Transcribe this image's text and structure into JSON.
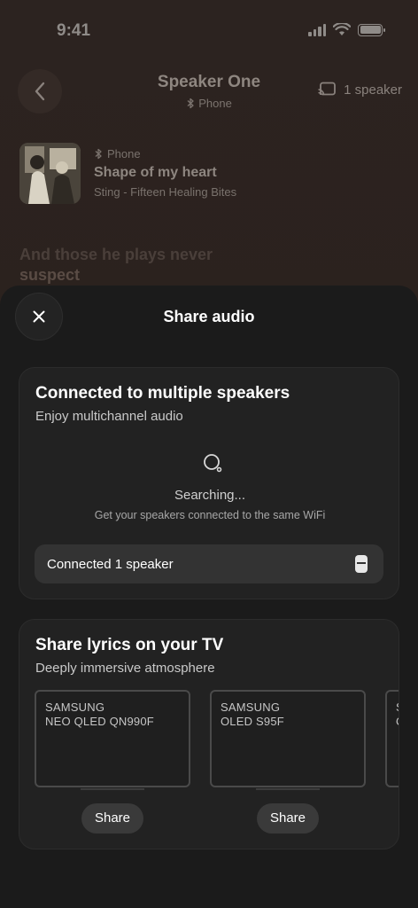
{
  "status": {
    "time": "9:41"
  },
  "header": {
    "title": "Speaker One",
    "source": "Phone",
    "cast_label": "1 speaker"
  },
  "now_playing": {
    "source": "Phone",
    "title": "Shape of my heart",
    "artist": "Sting - Fifteen Healing Bites"
  },
  "lyrics": {
    "line1": "And those he plays never",
    "line2": "suspect"
  },
  "sheet": {
    "title": "Share audio",
    "speakers_card": {
      "title": "Connected to multiple speakers",
      "subtitle": "Enjoy multichannel audio",
      "status": "Searching...",
      "hint": "Get your speakers connected to the same WiFi",
      "connected_label": "Connected 1 speaker"
    },
    "tv_card": {
      "title": "Share lyrics on your TV",
      "subtitle": "Deeply immersive atmosphere",
      "tvs": [
        {
          "brand": "SAMSUNG",
          "model": "NEO QLED QN990F",
          "share_label": "Share"
        },
        {
          "brand": "SAMSUNG",
          "model": "OLED S95F",
          "share_label": "Share"
        },
        {
          "brand": "S",
          "model": "O"
        }
      ]
    }
  }
}
